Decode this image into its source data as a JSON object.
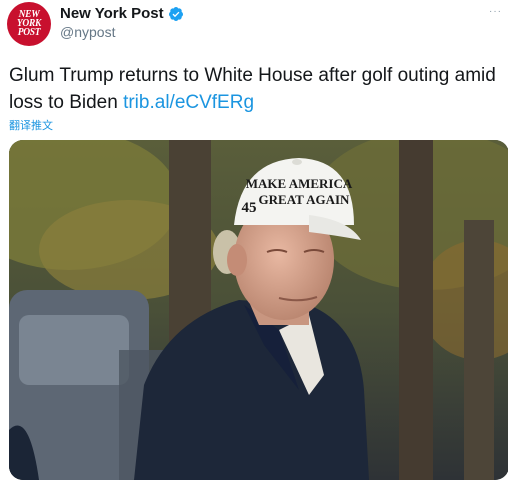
{
  "account": {
    "avatar_lines": [
      "NEW",
      "YORK",
      "POST"
    ],
    "name": "New York Post",
    "handle": "@nypost",
    "more_label": "···"
  },
  "tweet": {
    "text": "Glum Trump returns to White House after golf outing amid loss to Biden",
    "link": "trib.al/eCVfERg",
    "translate_label": "翻译推文"
  },
  "photo": {
    "hat_line1": "MAKE AMERICA",
    "hat_line2": "GREAT AGAIN",
    "hat_number": "45"
  },
  "colors": {
    "brand": "#c8102e",
    "link": "#1b95e0",
    "verified": "#1da1f2"
  }
}
